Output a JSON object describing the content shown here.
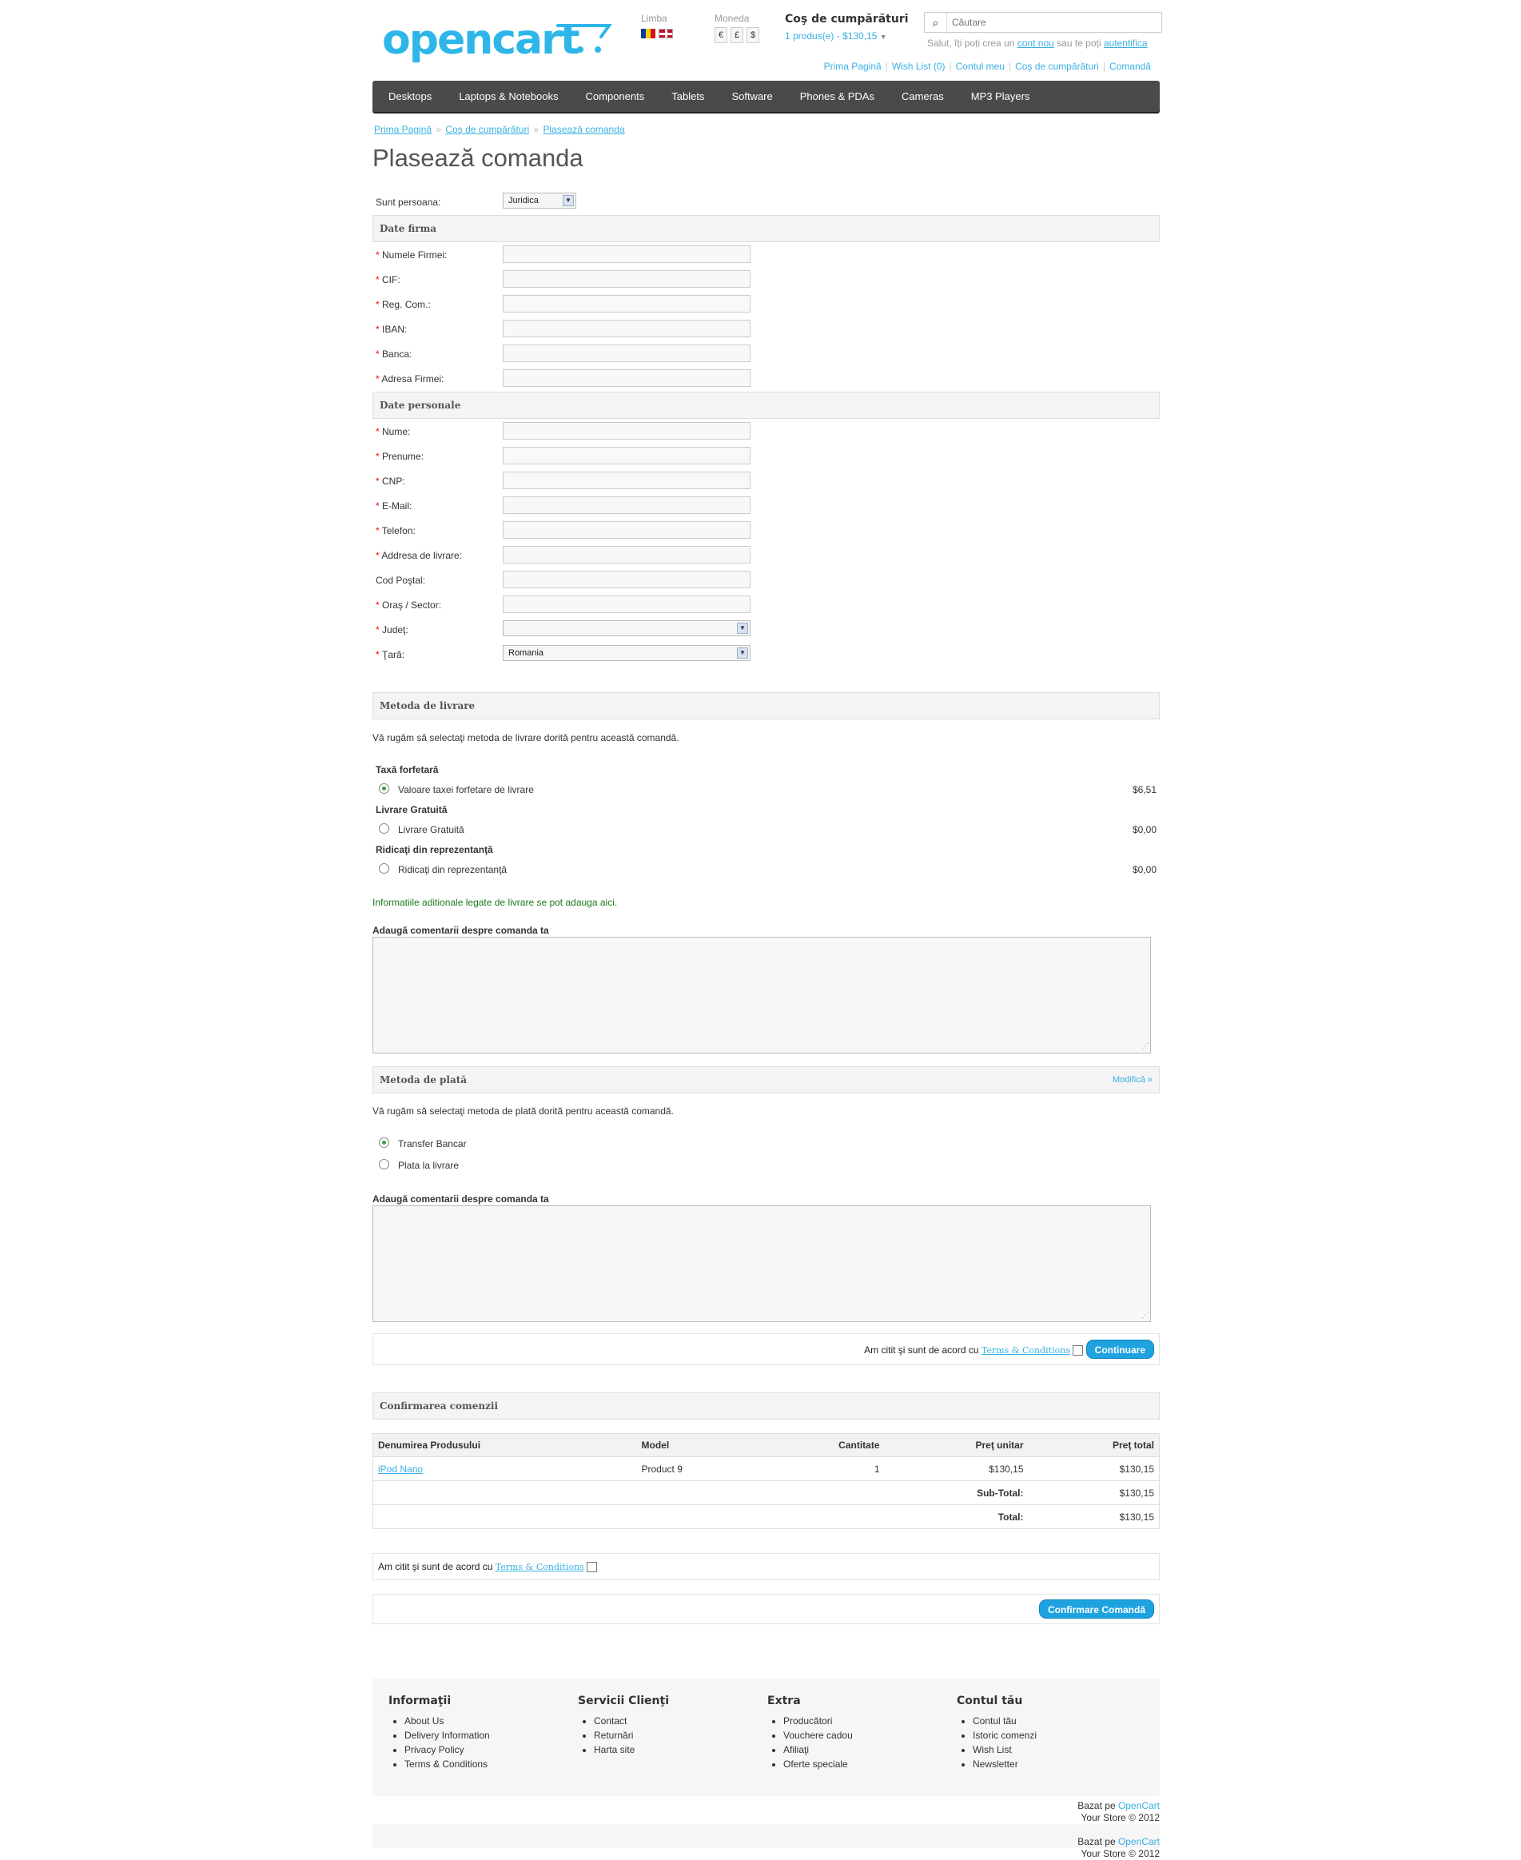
{
  "header": {
    "logo": "opencart",
    "lang_label": "Limba",
    "currency_label": "Moneda",
    "currencies": [
      "€",
      "£",
      "$"
    ],
    "cart_title": "Coş de cumpărături",
    "cart_total": "1 produs(e) - $130,15",
    "search_placeholder": "Căutare",
    "welcome_pre": "Salut, îți poți crea un",
    "welcome_link1": "cont nou",
    "welcome_mid": "sau te poți",
    "welcome_link2": "autentifica",
    "links": [
      "Prima Pagină",
      "Wish List (0)",
      "Contul meu",
      "Coş de cumpărături",
      "Comandă"
    ]
  },
  "menu": [
    "Desktops",
    "Laptops & Notebooks",
    "Components",
    "Tablets",
    "Software",
    "Phones & PDAs",
    "Cameras",
    "MP3 Players"
  ],
  "breadcrumb": [
    "Prima Pagină",
    "Coş de cumpărături",
    "Plasează comanda"
  ],
  "breadcrumb_sep": "»",
  "page_title": "Plasează comanda",
  "form": {
    "person_label": "Sunt persoana:",
    "person_value": "Juridica",
    "company_section": "Date firma",
    "company_fields": [
      "Numele Firmei:",
      "CIF:",
      "Reg. Com.:",
      "IBAN:",
      "Banca:",
      "Adresa Firmei:"
    ],
    "personal_section": "Date personale",
    "personal_fields": [
      {
        "label": "Nume:",
        "required": true
      },
      {
        "label": "Prenume:",
        "required": true
      },
      {
        "label": "CNP:",
        "required": true
      },
      {
        "label": "E-Mail:",
        "required": true
      },
      {
        "label": "Telefon:",
        "required": true
      },
      {
        "label": "Addresa de livrare:",
        "required": true
      },
      {
        "label": "Cod Poştal:",
        "required": false
      },
      {
        "label": "Oraş / Sector:",
        "required": true
      }
    ],
    "county_label": "Judeţ:",
    "county_value": "",
    "country_label": "Ţară:",
    "country_value": "Romania",
    "required_mark": "*"
  },
  "shipping": {
    "title": "Metoda de livrare",
    "intro": "Vă rugăm să selectaţi metoda de livrare dorită pentru această comandă.",
    "groups": [
      {
        "heading": "Taxă forfetară",
        "option": "Valoare taxei forfetare de livrare",
        "price": "$6,51",
        "selected": true
      },
      {
        "heading": "Livrare Gratuită",
        "option": "Livrare Gratuită",
        "price": "$0,00",
        "selected": false
      },
      {
        "heading": "Ridicaţi din reprezentanţă",
        "option": "Ridicaţi din reprezentanţă",
        "price": "$0,00",
        "selected": false
      }
    ],
    "info": "Informatiile aditionale legate de livrare se pot adauga aici.",
    "comment_label": "Adaugă comentarii despre comanda ta"
  },
  "payment": {
    "title": "Metoda de plată",
    "modify": "Modifică »",
    "intro": "Vă rugăm să selectaţi metoda de plată dorită pentru această comandă.",
    "options": [
      {
        "label": "Transfer Bancar",
        "selected": true
      },
      {
        "label": "Plata la livrare",
        "selected": false
      }
    ],
    "comment_label": "Adaugă comentarii despre comanda ta",
    "agree_text": "Am citit şi sunt de acord cu",
    "terms_link": "Terms & Conditions",
    "continue_button": "Continuare"
  },
  "confirm": {
    "title": "Confirmarea comenzii",
    "columns": [
      "Denumirea Produsului",
      "Model",
      "Cantitate",
      "Preţ unitar",
      "Preţ total"
    ],
    "rows": [
      {
        "name": "iPod Nano",
        "model": "Product 9",
        "qty": "1",
        "unit": "$130,15",
        "total": "$130,15"
      }
    ],
    "subtotal_label": "Sub-Total:",
    "subtotal": "$130,15",
    "total_label": "Total:",
    "total": "$130,15",
    "agree_text": "Am citit şi sunt de acord cu",
    "terms_link": "Terms & Conditions",
    "confirm_button": "Confirmare Comandă"
  },
  "footer": {
    "columns": [
      {
        "title": "Informaţii",
        "items": [
          "About Us",
          "Delivery Information",
          "Privacy Policy",
          "Terms & Conditions"
        ]
      },
      {
        "title": "Servicii Clienţi",
        "items": [
          "Contact",
          "Returnări",
          "Harta site"
        ]
      },
      {
        "title": "Extra",
        "items": [
          "Producători",
          "Vouchere cadou",
          "Afiliaţi",
          "Oferte speciale"
        ]
      },
      {
        "title": "Contul tău",
        "items": [
          "Contul tău",
          "Istoric comenzi",
          "Wish List",
          "Newsletter"
        ]
      }
    ],
    "powered_pre": "Bazat pe",
    "powered_link": "OpenCart",
    "copyright": "Your Store © 2012"
  },
  "colors": {
    "accent": "#38b0e3",
    "menu": "#4a4a4a",
    "button": "#1fa3e0"
  }
}
